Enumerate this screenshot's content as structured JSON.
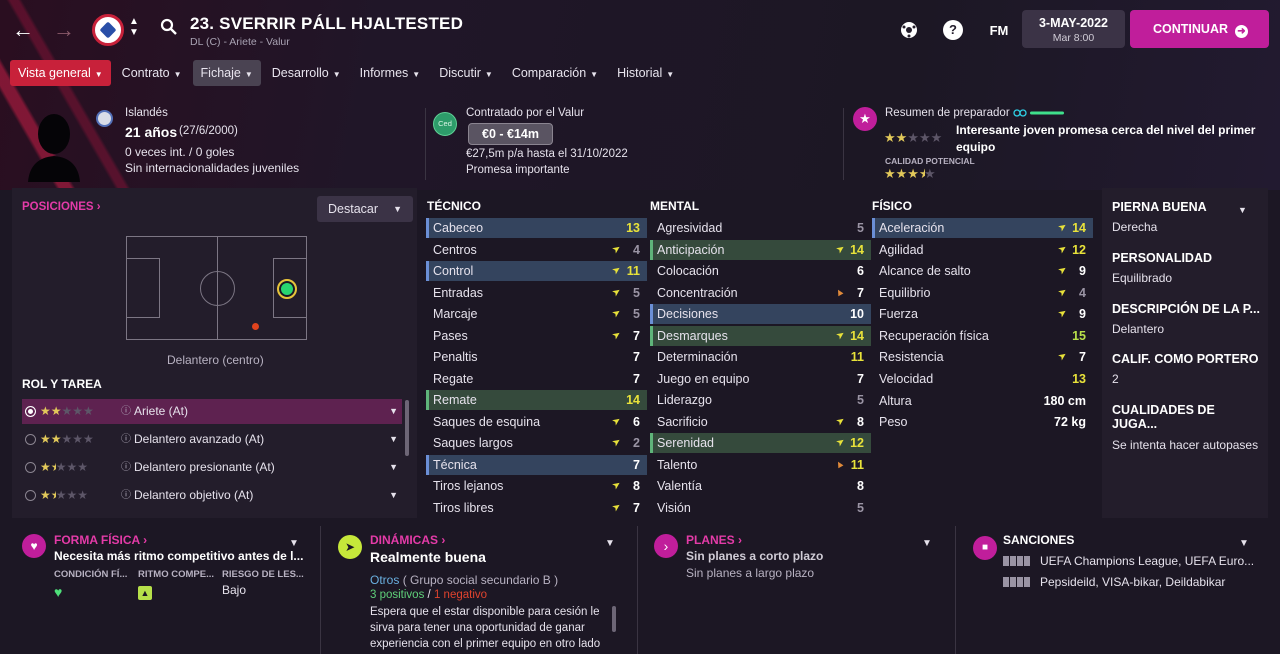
{
  "header": {
    "player_name": "23. SVERRIR PÁLL HJALTESTED",
    "subtitle": "DL (C) - Ariete - Valur",
    "fm_label": "FM",
    "date": "3-MAY-2022",
    "day_time": "Mar 8:00",
    "continue_label": "CONTINUAR"
  },
  "tabs": [
    {
      "label": "Vista general"
    },
    {
      "label": "Contrato"
    },
    {
      "label": "Fichaje"
    },
    {
      "label": "Desarrollo"
    },
    {
      "label": "Informes"
    },
    {
      "label": "Discutir"
    },
    {
      "label": "Comparación"
    },
    {
      "label": "Historial"
    }
  ],
  "profile": {
    "nationality": "Islandés",
    "age": "21 años",
    "dob": "(27/6/2000)",
    "caps": "0 veces int. / 0 goles",
    "youth": "Sin internacionalidades juveniles"
  },
  "contract": {
    "badge": "Ced",
    "contracted_by": "Contratado por el Valur",
    "value": "€0 - €14m",
    "wage": "€27,5m p/a hasta el 31/10/2022",
    "status": "Promesa importante"
  },
  "coach": {
    "title": "Resumen de preparador",
    "report": "Interesante joven promesa cerca del nivel del primer equipo",
    "potential_label": "CALIDAD POTENCIAL",
    "current_stars": 2,
    "potential_stars": 3.5
  },
  "positions": {
    "title": "POSICIONES",
    "highlight_label": "Destacar",
    "position_caption": "Delantero (centro)"
  },
  "roles": {
    "title": "ROL Y TAREA",
    "items": [
      {
        "label": "Ariete (At)",
        "stars": 2
      },
      {
        "label": "Delantero avanzado (At)",
        "stars": 2
      },
      {
        "label": "Delantero presionante (At)",
        "stars": 1.5
      },
      {
        "label": "Delantero objetivo (At)",
        "stars": 1.5
      }
    ]
  },
  "attributes": {
    "tecnico_title": "TÉCNICO",
    "mental_title": "MENTAL",
    "fisico_title": "FÍSICO",
    "tecnico": [
      {
        "name": "Cabeceo",
        "value": "13",
        "hl": "blue",
        "arrow": "",
        "vc": "y"
      },
      {
        "name": "Centros",
        "value": "4",
        "hl": "",
        "arrow": "y",
        "vc": "g"
      },
      {
        "name": "Control",
        "value": "11",
        "hl": "blue",
        "arrow": "y",
        "vc": "y"
      },
      {
        "name": "Entradas",
        "value": "5",
        "hl": "",
        "arrow": "y",
        "vc": "g"
      },
      {
        "name": "Marcaje",
        "value": "5",
        "hl": "",
        "arrow": "y",
        "vc": "g"
      },
      {
        "name": "Pases",
        "value": "7",
        "hl": "",
        "arrow": "y",
        "vc": "w"
      },
      {
        "name": "Penaltis",
        "value": "7",
        "hl": "",
        "arrow": "",
        "vc": "w"
      },
      {
        "name": "Regate",
        "value": "7",
        "hl": "",
        "arrow": "",
        "vc": "w"
      },
      {
        "name": "Remate",
        "value": "14",
        "hl": "green",
        "arrow": "",
        "vc": "y"
      },
      {
        "name": "Saques de esquina",
        "value": "6",
        "hl": "",
        "arrow": "y",
        "vc": "w"
      },
      {
        "name": "Saques largos",
        "value": "2",
        "hl": "",
        "arrow": "y",
        "vc": "g"
      },
      {
        "name": "Técnica",
        "value": "7",
        "hl": "blue",
        "arrow": "",
        "vc": "w"
      },
      {
        "name": "Tiros lejanos",
        "value": "8",
        "hl": "",
        "arrow": "y",
        "vc": "w"
      },
      {
        "name": "Tiros libres",
        "value": "7",
        "hl": "",
        "arrow": "y",
        "vc": "w"
      }
    ],
    "mental": [
      {
        "name": "Agresividad",
        "value": "5",
        "hl": "",
        "arrow": "",
        "vc": "g"
      },
      {
        "name": "Anticipación",
        "value": "14",
        "hl": "green",
        "arrow": "y",
        "vc": "y"
      },
      {
        "name": "Colocación",
        "value": "6",
        "hl": "",
        "arrow": "",
        "vc": "w"
      },
      {
        "name": "Concentración",
        "value": "7",
        "hl": "",
        "arrow": "o",
        "vc": "w"
      },
      {
        "name": "Decisiones",
        "value": "10",
        "hl": "blue",
        "arrow": "",
        "vc": "w"
      },
      {
        "name": "Desmarques",
        "value": "14",
        "hl": "green",
        "arrow": "y",
        "vc": "y"
      },
      {
        "name": "Determinación",
        "value": "11",
        "hl": "",
        "arrow": "",
        "vc": "y"
      },
      {
        "name": "Juego en equipo",
        "value": "7",
        "hl": "",
        "arrow": "",
        "vc": "w"
      },
      {
        "name": "Liderazgo",
        "value": "5",
        "hl": "",
        "arrow": "",
        "vc": "g"
      },
      {
        "name": "Sacrificio",
        "value": "8",
        "hl": "",
        "arrow": "y",
        "vc": "w"
      },
      {
        "name": "Serenidad",
        "value": "12",
        "hl": "green",
        "arrow": "y",
        "vc": "y"
      },
      {
        "name": "Talento",
        "value": "11",
        "hl": "",
        "arrow": "o",
        "vc": "y"
      },
      {
        "name": "Valentía",
        "value": "8",
        "hl": "",
        "arrow": "",
        "vc": "w"
      },
      {
        "name": "Visión",
        "value": "5",
        "hl": "",
        "arrow": "",
        "vc": "g"
      }
    ],
    "fisico": [
      {
        "name": "Aceleración",
        "value": "14",
        "hl": "blue",
        "arrow": "y",
        "vc": "y"
      },
      {
        "name": "Agilidad",
        "value": "12",
        "hl": "",
        "arrow": "y",
        "vc": "y"
      },
      {
        "name": "Alcance de salto",
        "value": "9",
        "hl": "",
        "arrow": "y",
        "vc": "w"
      },
      {
        "name": "Equilibrio",
        "value": "4",
        "hl": "",
        "arrow": "y",
        "vc": "g"
      },
      {
        "name": "Fuerza",
        "value": "9",
        "hl": "",
        "arrow": "y",
        "vc": "w"
      },
      {
        "name": "Recuperación física",
        "value": "15",
        "hl": "",
        "arrow": "",
        "vc": "gr"
      },
      {
        "name": "Resistencia",
        "value": "7",
        "hl": "",
        "arrow": "y",
        "vc": "w"
      },
      {
        "name": "Velocidad",
        "value": "13",
        "hl": "",
        "arrow": "",
        "vc": "y"
      }
    ],
    "altura_label": "Altura",
    "altura": "180 cm",
    "peso_label": "Peso",
    "peso": "72 kg"
  },
  "side": {
    "pierna_title": "PIERNA BUENA",
    "pierna": "Derecha",
    "personalidad_title": "PERSONALIDAD",
    "personalidad": "Equilibrado",
    "descripcion_title": "DESCRIPCIÓN DE LA P...",
    "descripcion": "Delantero",
    "portero_title": "CALIF. COMO PORTERO",
    "portero": "2",
    "cualidades_title": "CUALIDADES DE JUGA...",
    "cualidades": "Se intenta hacer autopases"
  },
  "forma": {
    "title": "FORMA FÍSICA",
    "text": "Necesita más ritmo competitivo antes de l...",
    "col1": "CONDICIÓN FÍ...",
    "col2": "RITMO COMPE...",
    "col3": "RIESGO DE LES...",
    "riesgo": "Bajo"
  },
  "dinamicas": {
    "title": "DINÁMICAS",
    "text": "Realmente buena",
    "group": "Otros",
    "group_desc": "( Grupo social secundario B )",
    "pos": "3 positivos",
    "sep": "/",
    "neg": "1 negativo",
    "desc": "Espera que el estar disponible para cesión le sirva para tener una oportunidad de ganar experiencia con el primer equipo en otro lado"
  },
  "planes": {
    "title": "PLANES",
    "short": "Sin planes a corto plazo",
    "long": "Sin planes a largo plazo"
  },
  "sanciones": {
    "title": "SANCIONES",
    "line1": "UEFA Champions League, UEFA Euro...",
    "line2": "Pepsideild, VISA-bikar, Deildabikar"
  },
  "colors": {
    "accent": "#c01e9b",
    "tab_active": "#c8213a",
    "pink": "#e43ba8"
  }
}
